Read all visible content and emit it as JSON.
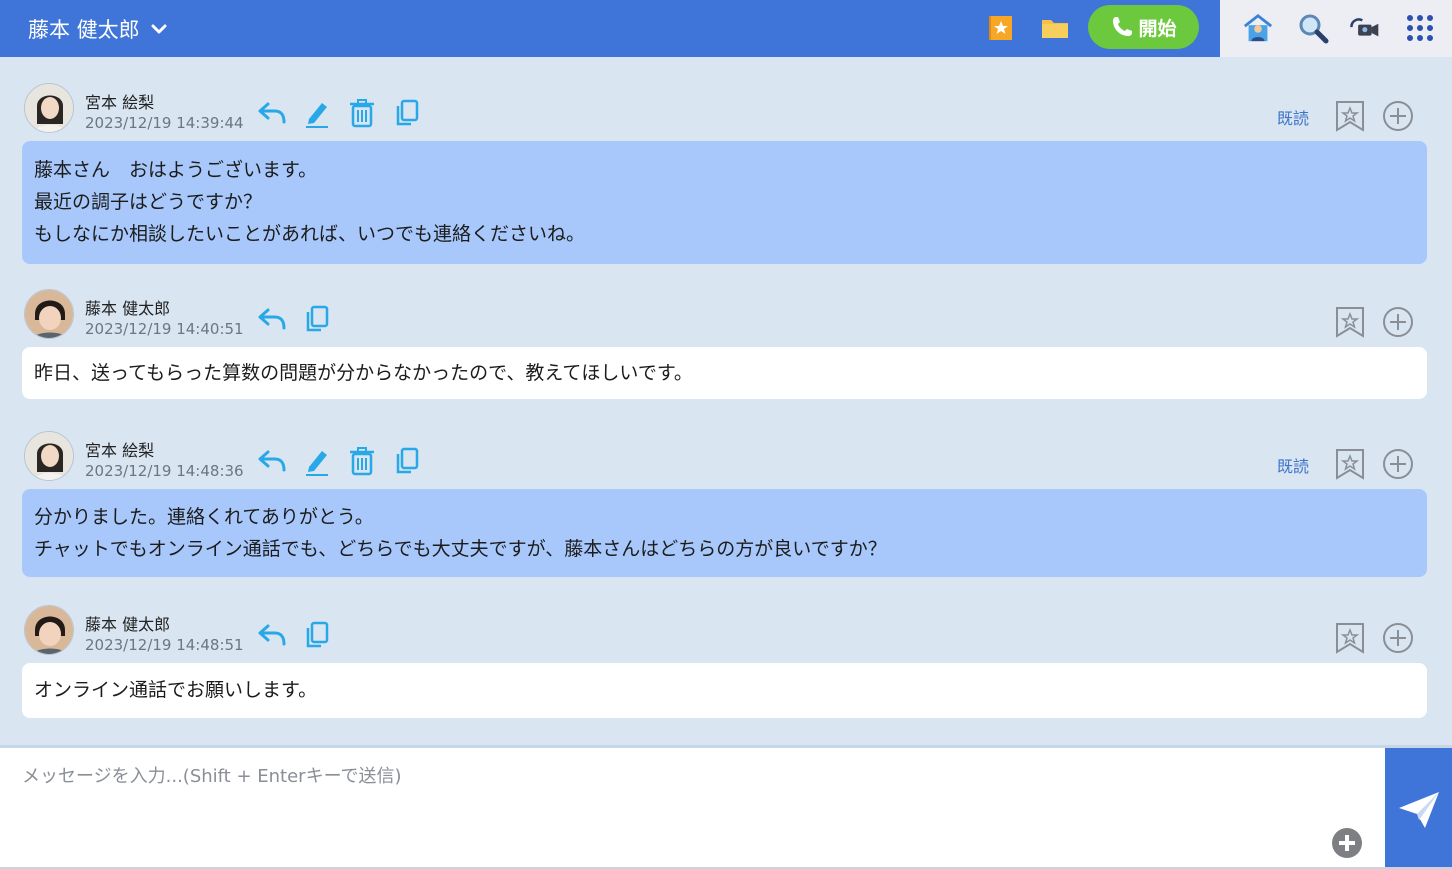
{
  "header": {
    "contact_name": "藤本 健太郎",
    "call_button_label": "開始"
  },
  "messages": [
    {
      "sender": "宮本 絵梨",
      "timestamp": "2023/12/19 14:39:44",
      "read_label": "既読",
      "lines": [
        "藤本さん　おはようございます。",
        "最近の調子はどうですか？",
        "もしなにか相談したいことがあれば、いつでも連絡くださいね。"
      ]
    },
    {
      "sender": "藤本 健太郎",
      "timestamp": "2023/12/19 14:40:51",
      "lines": [
        "昨日、送ってもらった算数の問題が分からなかったので、教えてほしいです。"
      ]
    },
    {
      "sender": "宮本 絵梨",
      "timestamp": "2023/12/19 14:48:36",
      "read_label": "既読",
      "lines": [
        "分かりました。連絡くれてありがとう。",
        "チャットでもオンライン通話でも、どちらでも大丈夫ですが、藤本さんはどちらの方が良いですか？"
      ]
    },
    {
      "sender": "藤本 健太郎",
      "timestamp": "2023/12/19 14:48:51",
      "lines": [
        "オンライン通話でお願いします。"
      ]
    }
  ],
  "composer": {
    "placeholder": "メッセージを入力...(Shift + Enterキーで送信)",
    "value": ""
  },
  "icons": {
    "header": [
      "chevron-down-icon",
      "favorites-icon",
      "folder-icon",
      "phone-icon",
      "home-user-icon",
      "search-icon",
      "video-call-icon",
      "app-grid-icon"
    ],
    "message_actions": [
      "reply-icon",
      "edit-icon",
      "delete-icon",
      "copy-icon",
      "bookmark-star-icon",
      "add-circle-icon"
    ],
    "composer": [
      "attach-plus-icon",
      "send-icon"
    ]
  },
  "colors": {
    "header_blue": "#3f74d9",
    "call_green": "#6cc93d",
    "own_bubble": "#a8c8fb",
    "other_bubble": "#ffffff",
    "chat_bg": "#d9e6f2",
    "action_icon": "#29a8e8",
    "read_label": "#3d73c8"
  }
}
